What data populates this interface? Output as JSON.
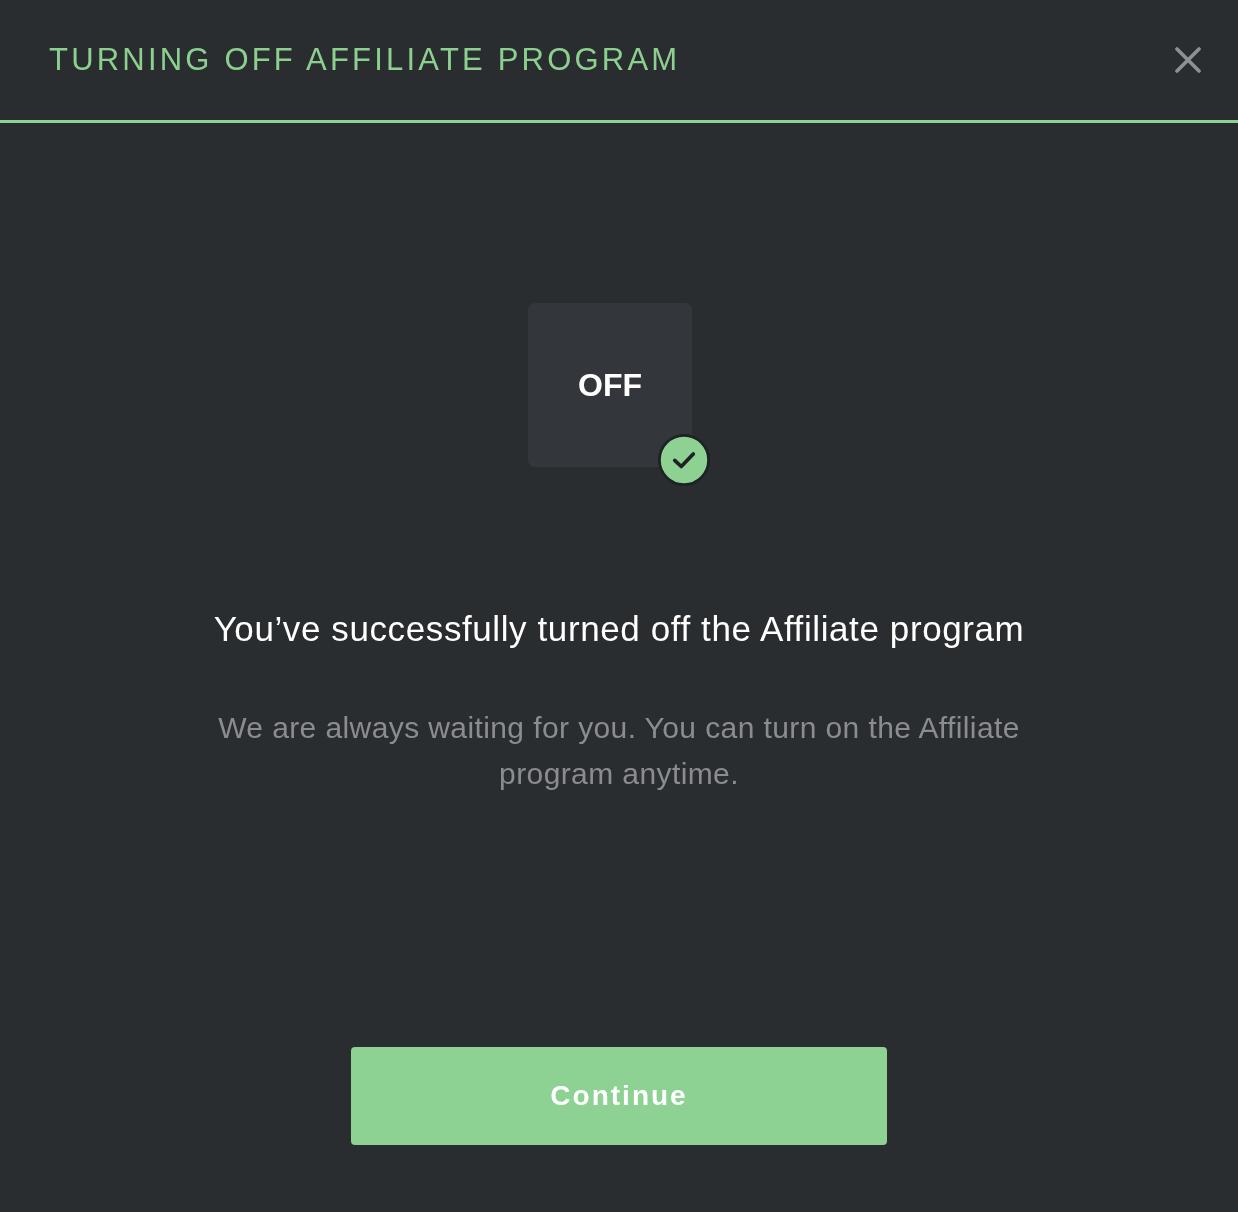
{
  "dialog": {
    "title": "TURNING OFF AFFILIATE PROGRAM"
  },
  "status_tile": {
    "label": "OFF",
    "confirmed": true
  },
  "heading": "You’ve successfully turned off the Affiliate program",
  "message": "We are always waiting for you. You can turn on the Affiliate program anytime.",
  "buttons": [
    {
      "label": "Continue",
      "kind": "primary"
    }
  ]
}
